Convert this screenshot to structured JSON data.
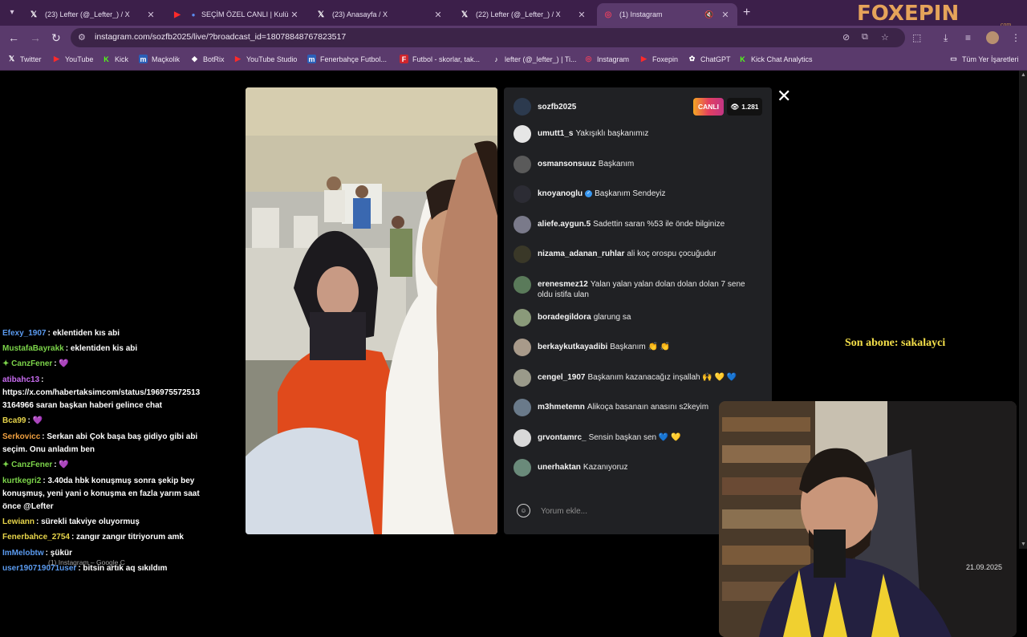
{
  "tabs": [
    {
      "title": "(23) Lefter (@_Lefter_) / X",
      "icon": "x-icon"
    },
    {
      "title": "SEÇİM ÖZEL CANLI | Kulübü",
      "icon": "youtube-icon"
    },
    {
      "title": "(23) Anasayfa / X",
      "icon": "x-icon"
    },
    {
      "title": "(22) Lefter (@_Lefter_) / X",
      "icon": "x-icon"
    },
    {
      "title": "(1) Instagram",
      "icon": "instagram-icon"
    }
  ],
  "brand": {
    "logo": "FOXEPIN",
    "sub": ".com"
  },
  "address": {
    "url": "instagram.com/sozfb2025/live/?broadcast_id=18078848767823517"
  },
  "bookmarks": [
    {
      "label": "Twitter",
      "icon": "x-icon"
    },
    {
      "label": "YouTube",
      "icon": "youtube-icon"
    },
    {
      "label": "Kick",
      "icon": "kick-icon"
    },
    {
      "label": "Maçkolik",
      "icon": "mackolik-icon"
    },
    {
      "label": "BotRix",
      "icon": "botrix-icon"
    },
    {
      "label": "YouTube Studio",
      "icon": "youtube-icon"
    },
    {
      "label": "Fenerbahçe Futbol...",
      "icon": "mackolik-icon"
    },
    {
      "label": "Futbol - skorlar, tak...",
      "icon": "flashscore-icon"
    },
    {
      "label": "lefter (@_lefter_) | Ti...",
      "icon": "tiktok-icon"
    },
    {
      "label": "Instagram",
      "icon": "instagram-icon"
    },
    {
      "label": "Foxepin",
      "icon": "youtube-icon"
    },
    {
      "label": "ChatGPT",
      "icon": "chatgpt-icon"
    },
    {
      "label": "Kick Chat Analytics",
      "icon": "kick-icon"
    },
    {
      "label": "Tüm Yer İşaretleri",
      "icon": "folder-icon"
    }
  ],
  "live": {
    "host": "sozfb2025",
    "badge": "CANLI",
    "viewers": "1.281",
    "comment_placeholder": "Yorum ekle...",
    "comments": [
      {
        "user": "umutt1_s",
        "text": "Yakışıklı başkanımız",
        "verified": false
      },
      {
        "user": "osmansonsuuz",
        "text": "Başkanım",
        "verified": false
      },
      {
        "user": "knoyanoglu",
        "text": "Başkanım Sendeyiz",
        "verified": true
      },
      {
        "user": "aliefe.aygun.5",
        "text": "Sadettin saran %53 ile önde bilginize",
        "verified": false
      },
      {
        "user": "nizama_adanan_ruhlar",
        "text": "ali koç orospu çocuğudur",
        "verified": false
      },
      {
        "user": "erenesmez12",
        "text": "Yalan yalan yalan dolan dolan dolan 7 sene oldu istifa ulan",
        "verified": false
      },
      {
        "user": "boradegildora",
        "text": "glarung sa",
        "verified": false
      },
      {
        "user": "berkaykutkayadibi",
        "text": "Başkanım 👏 👏",
        "verified": false
      },
      {
        "user": "cengel_1907",
        "text": "Başkanım kazanacağız inşallah 🙌 💛 💙",
        "verified": false
      },
      {
        "user": "m3hmetemn",
        "text": "Alikoça basanaın anasını s2keyim",
        "verified": false
      },
      {
        "user": "grvontamrc_",
        "text": "Sensin başkan sen 💙 💛",
        "verified": false
      },
      {
        "user": "unerhaktan",
        "text": "Kazanıyoruz",
        "verified": false
      }
    ]
  },
  "stream_chat": [
    {
      "user": "Efexy_1907",
      "text": ": eklentiden kıs abi",
      "color": "#5b9bf0"
    },
    {
      "user": "MustafaBayrakk",
      "text": ": eklentiden kis abi",
      "color": "#7cd44a"
    },
    {
      "user": "CanzFener",
      "text": ":",
      "color": "#7cd44a",
      "heart": "💜"
    },
    {
      "user": "atibahc13",
      "text": ":",
      "color": "#c86cf0"
    },
    {
      "user": "",
      "text": "https://x.com/habertaksimcom/status/196975572513",
      "color": "#ffffff"
    },
    {
      "user": "",
      "text": "3164966 saran başkan haberi gelince chat",
      "color": "#ffffff"
    },
    {
      "user": "Bca99",
      "text": ":",
      "color": "#e6d44a",
      "heart": "💜"
    },
    {
      "user": "Serkovicc",
      "text": ": Serkan abi Çok başa baş gidiyo gibi abi",
      "color": "#f0a040"
    },
    {
      "user": "",
      "text": "seçim. Onu anladım ben",
      "color": "#ffffff"
    },
    {
      "user": "CanzFener",
      "text": ":",
      "color": "#7cd44a",
      "heart": "💜"
    },
    {
      "user": "kurtkegri2",
      "text": ": 3.40da hbk konuşmuş sonra şekip bey",
      "color": "#7cd44a"
    },
    {
      "user": "",
      "text": "konuşmuş, yeni yani o konuşma en fazla yarım saat",
      "color": "#ffffff"
    },
    {
      "user": "",
      "text": "önce @Lefter",
      "color": "#ffffff"
    },
    {
      "user": "Lewiann",
      "text": ": sürekli takviye oluyormuş",
      "color": "#e6d44a"
    },
    {
      "user": "Fenerbahce_2754",
      "text": ": zangır zangır titriyorum amk",
      "color": "#e6d44a"
    },
    {
      "user": "ImMelobtw",
      "text": ": şükür",
      "color": "#5b9bf0"
    },
    {
      "user": "user190719071user",
      "text": ": bitsin artık aq sıkıldım",
      "color": "#5b9bf0"
    }
  ],
  "overlay": {
    "sub_label": "Son abone: sakalayci",
    "date": "21.09.2025",
    "taskbar_ghost": "(1) Instagram – Google C"
  },
  "colors": {
    "chrome_dark": "#3c1f4a",
    "chrome": "#5a3a6c",
    "live_gradient": "#e4405f",
    "subscriber_text": "#f5e04a"
  }
}
